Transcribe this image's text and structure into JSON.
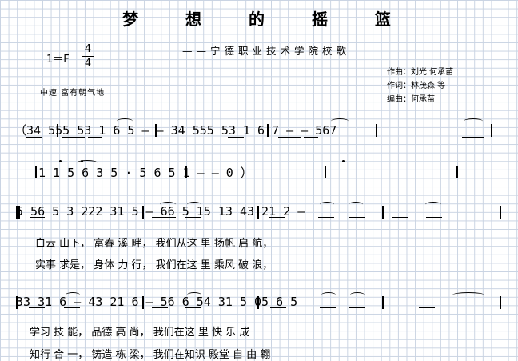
{
  "title": "梦 想 的 摇 篮",
  "subtitle": "——宁德职业技术学院校歌",
  "key": "1＝F",
  "time_sig": {
    "num": "4",
    "den": "4"
  },
  "tempo": "中速 富有朝气地",
  "credits": [
    "作曲：刘光  何承苗",
    "作词：林茂森 等",
    "编曲：何承苗"
  ],
  "staff": [
    "（34   555 53 1 6    5 — — 34   555 53 1 6     7 — — 567",
    "  1 1 5 6 3   5 · 5 6 5    1 — — 0 ）",
    "  5 56 5 3   222 31 5 —   66 5 15 13   43 21 2 —",
    "  33 31 6 —   43 21 6 —   56 6 54 31   5 05 6 5"
  ],
  "lyrics": [
    "白云 山下，    富春 溪 畔，    我们从这 里    扬帆 启 航，",
    "实事 求是，    身体 力 行，    我们在这 里    乘风 破 浪，",
    "学习 技 能，    品德 高 尚，    我们在这 里    快 乐 成",
    "知行 合 一，    铸造 栋 梁，    我们在知识 殿堂    自 由 翱"
  ]
}
